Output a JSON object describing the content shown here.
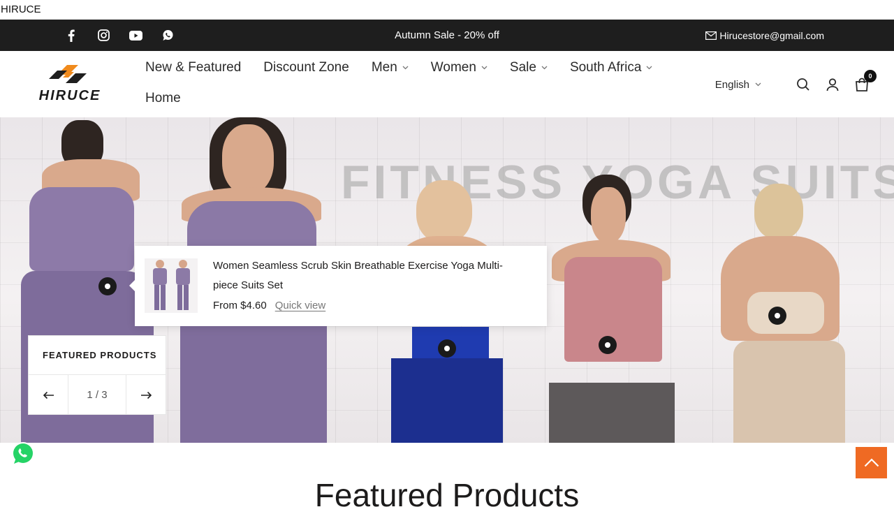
{
  "site_title": "HIRUCE",
  "announcement": {
    "text": "Autumn Sale - 20% off",
    "email": "Hirucestore@gmail.com",
    "social_icons": [
      "facebook-icon",
      "instagram-icon",
      "youtube-icon",
      "whatsapp-icon"
    ]
  },
  "header": {
    "logo_text": "HIRUCE",
    "nav": {
      "row1": [
        {
          "label": "New & Featured",
          "dropdown": false
        },
        {
          "label": "Discount Zone",
          "dropdown": false
        },
        {
          "label": "Men",
          "dropdown": true
        },
        {
          "label": "Women",
          "dropdown": true
        },
        {
          "label": "Sale",
          "dropdown": true
        },
        {
          "label": "South Africa",
          "dropdown": true
        }
      ],
      "row2": [
        {
          "label": "Home",
          "dropdown": false
        }
      ]
    },
    "language": "English",
    "cart_count": "0",
    "icons": [
      "search-icon",
      "account-icon",
      "cart-icon"
    ]
  },
  "hero": {
    "headline": "FITNESS YOGA SUITS",
    "product_popup": {
      "name": "Women Seamless Scrub Skin Breathable Exercise Yoga Multi-piece Suits Set",
      "price": "From $4.60",
      "quick_view": "Quick view"
    },
    "featured": {
      "label": "FEATURED PRODUCTS",
      "pager": "1 / 3"
    }
  },
  "section_title": "Featured Products",
  "colors": {
    "announce_bg": "#1e1e1e",
    "accent": "#ef6a23",
    "whatsapp": "#25d366",
    "logo_orange": "#f08a1c"
  }
}
